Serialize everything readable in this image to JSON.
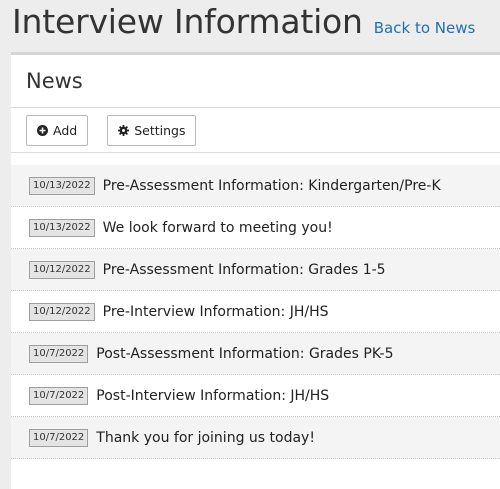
{
  "header": {
    "title": "Interview Information",
    "back_link": "Back to News"
  },
  "panel": {
    "title": "News",
    "add_label": "Add",
    "settings_label": "Settings"
  },
  "news": [
    {
      "date": "10/13/2022",
      "title": "Pre-Assessment Information: Kindergarten/Pre-K"
    },
    {
      "date": "10/13/2022",
      "title": "We look forward to meeting you!"
    },
    {
      "date": "10/12/2022",
      "title": "Pre-Assessment Information: Grades 1-5"
    },
    {
      "date": "10/12/2022",
      "title": "Pre-Interview Information: JH/HS"
    },
    {
      "date": "10/7/2022",
      "title": "Post-Assessment Information: Grades PK-5"
    },
    {
      "date": "10/7/2022",
      "title": "Post-Interview Information: JH/HS"
    },
    {
      "date": "10/7/2022",
      "title": "Thank you for joining us today!"
    }
  ],
  "icons": {
    "add": "plus-circle-icon",
    "settings": "gear-icon"
  },
  "colors": {
    "link": "#1f6fb5",
    "page_background": "#ededed"
  }
}
